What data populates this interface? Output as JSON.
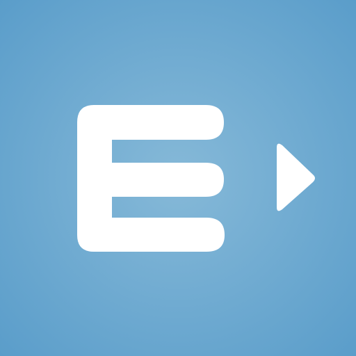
{
  "app_icon": {
    "glyph_icon": "letter-e-icon",
    "arrow_icon": "play-triangle-icon",
    "colors": {
      "background_center": "#86b9d8",
      "background_edge": "#5a9dca",
      "foreground": "#ffffff"
    }
  }
}
